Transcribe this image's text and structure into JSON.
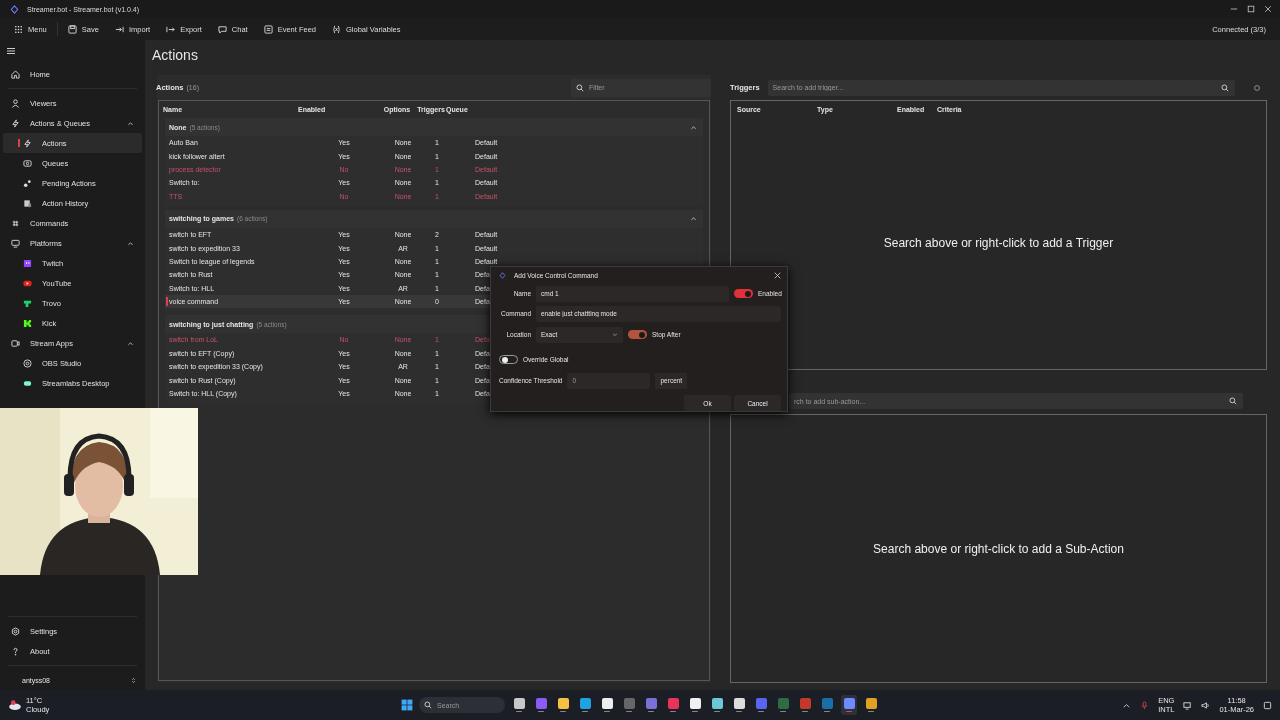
{
  "window": {
    "title": "Streamer.bot - Streamer.bot (v1.0.4)"
  },
  "toolbar": {
    "items": [
      {
        "label": "Menu"
      },
      {
        "label": "Save"
      },
      {
        "label": "Import"
      },
      {
        "label": "Export"
      },
      {
        "label": "Chat"
      },
      {
        "label": "Event Feed"
      },
      {
        "label": "Global Variables"
      }
    ],
    "status": "Connected (3/3)"
  },
  "sidebar": {
    "items": [
      {
        "label": "Home",
        "selected": false
      },
      {
        "label": "Viewers",
        "selected": false
      },
      {
        "label": "Actions & Queues",
        "selected": false,
        "expanded": true,
        "children": [
          {
            "label": "Actions",
            "selected": true
          },
          {
            "label": "Queues",
            "selected": false
          },
          {
            "label": "Pending Actions",
            "selected": false
          },
          {
            "label": "Action History",
            "selected": false
          }
        ]
      },
      {
        "label": "Commands",
        "selected": false
      },
      {
        "label": "Platforms",
        "selected": false,
        "expanded": true,
        "children": [
          {
            "label": "Twitch",
            "selected": false
          },
          {
            "label": "YouTube",
            "selected": false
          },
          {
            "label": "Trovo",
            "selected": false
          },
          {
            "label": "Kick",
            "selected": false
          }
        ]
      },
      {
        "label": "Stream Apps",
        "selected": false,
        "expanded": true,
        "children": [
          {
            "label": "OBS Studio",
            "selected": false
          },
          {
            "label": "Streamlabs Desktop",
            "selected": false
          }
        ]
      }
    ],
    "footer": [
      {
        "label": "Settings"
      },
      {
        "label": "About"
      }
    ],
    "user": "antyss08"
  },
  "page_title": "Actions",
  "actions_panel": {
    "title": "Actions",
    "count": "(16)",
    "filter": {
      "placeholder": "Filter"
    },
    "columns": [
      "Name",
      "Enabled",
      "Options",
      "Triggers",
      "Queue"
    ],
    "groups": [
      {
        "name": "None",
        "count": "(5 actions)",
        "expanded": true,
        "rows": [
          {
            "name": "Auto Ban",
            "enabled_text": "Yes",
            "options": "None",
            "triggers": "1",
            "queue": "Default",
            "enabled": true,
            "selected": false
          },
          {
            "name": "kick follower altert",
            "enabled_text": "Yes",
            "options": "None",
            "triggers": "1",
            "queue": "Default",
            "enabled": true,
            "selected": false
          },
          {
            "name": "process detector",
            "enabled_text": "No",
            "options": "None",
            "triggers": "1",
            "queue": "Default",
            "enabled": false,
            "selected": false
          },
          {
            "name": "Switch to:",
            "enabled_text": "Yes",
            "options": "None",
            "triggers": "1",
            "queue": "Default",
            "enabled": true,
            "selected": false
          },
          {
            "name": "TTS",
            "enabled_text": "No",
            "options": "None",
            "triggers": "1",
            "queue": "Default",
            "enabled": false,
            "selected": false
          }
        ]
      },
      {
        "name": "switching to games",
        "count": "(6 actions)",
        "expanded": true,
        "rows": [
          {
            "name": "switch to EFT",
            "enabled_text": "Yes",
            "options": "None",
            "triggers": "2",
            "queue": "Default",
            "enabled": true,
            "selected": false
          },
          {
            "name": "switch to expedition 33",
            "enabled_text": "Yes",
            "options": "AR",
            "triggers": "1",
            "queue": "Default",
            "enabled": true,
            "selected": false
          },
          {
            "name": "Switch to league of legends",
            "enabled_text": "Yes",
            "options": "None",
            "triggers": "1",
            "queue": "Default",
            "enabled": true,
            "selected": false
          },
          {
            "name": "switch to Rust",
            "enabled_text": "Yes",
            "options": "None",
            "triggers": "1",
            "queue": "Defa",
            "enabled": true,
            "selected": false
          },
          {
            "name": "Switch to: HLL",
            "enabled_text": "Yes",
            "options": "AR",
            "triggers": "1",
            "queue": "Defa",
            "enabled": true,
            "selected": false
          },
          {
            "name": "voice command",
            "enabled_text": "Yes",
            "options": "None",
            "triggers": "0",
            "queue": "Defa",
            "enabled": true,
            "selected": true
          }
        ]
      },
      {
        "name": "switching to just chatting",
        "count": "(5 actions)",
        "rows": [
          {
            "name": "switch from LoL",
            "enabled_text": "No",
            "options": "None",
            "triggers": "1",
            "queue": "Defa",
            "enabled": false,
            "selected": false
          },
          {
            "name": "switch to EFT (Copy)",
            "enabled_text": "Yes",
            "options": "None",
            "triggers": "1",
            "queue": "Defa",
            "enabled": true,
            "selected": false
          },
          {
            "name": "switch to expedition 33 (Copy)",
            "enabled_text": "Yes",
            "options": "AR",
            "triggers": "1",
            "queue": "Defa",
            "enabled": true,
            "selected": false
          },
          {
            "name": "switch to Rust (Copy)",
            "enabled_text": "Yes",
            "options": "None",
            "triggers": "1",
            "queue": "Defa",
            "enabled": true,
            "selected": false
          },
          {
            "name": "Switch to: HLL (Copy)",
            "enabled_text": "Yes",
            "options": "None",
            "triggers": "1",
            "queue": "Defa",
            "enabled": true,
            "selected": false
          }
        ]
      }
    ]
  },
  "triggers_panel": {
    "title": "Triggers",
    "search": {
      "placeholder": "Search to add trigger..."
    },
    "columns": [
      "Source",
      "Type",
      "Enabled",
      "Criteria"
    ],
    "empty_message": "Search above or right-click to add a Trigger"
  },
  "subactions_panel": {
    "search": {
      "placeholder": "rch to add sub-action..."
    },
    "empty_message": "Search above or right-click to add a Sub-Action"
  },
  "dialog": {
    "title": "Add Voice Control Command",
    "name_label": "Name",
    "name_value": "cmd 1",
    "enabled_label": "Enabled",
    "enabled": true,
    "command_label": "Command",
    "command_value": "enable just chattting mode",
    "location_label": "Location",
    "location_value": "Exact",
    "stop_after_label": "Stop After",
    "stop_after": true,
    "override_label": "Override Global",
    "override_global": false,
    "threshold_label": "Confidence Threshold",
    "threshold_placeholder": "0",
    "threshold_unit": "percent",
    "buttons": [
      "Ok",
      "Cancel"
    ]
  },
  "taskbar": {
    "weather": {
      "temp": "11°C",
      "condition": "Cloudy"
    },
    "search": {
      "placeholder": "Search"
    },
    "apps": [
      {
        "color": "#c8c8c8",
        "active": false
      },
      {
        "color": "#8a5cf6",
        "active": false
      },
      {
        "color": "#f5c242",
        "active": false
      },
      {
        "color": "#1fa2e0",
        "active": false
      },
      {
        "color": "#eeeeee",
        "active": false
      },
      {
        "color": "#666666",
        "active": false
      },
      {
        "color": "#7b6fd8",
        "active": false
      },
      {
        "color": "#e8335a",
        "active": false
      },
      {
        "color": "#f0f0f0",
        "active": false
      },
      {
        "color": "#6cc7d8",
        "active": false
      },
      {
        "color": "#dddddd",
        "active": false
      },
      {
        "color": "#5865f2",
        "active": false
      },
      {
        "color": "#2f6b45",
        "active": false
      },
      {
        "color": "#c0392b",
        "active": false
      },
      {
        "color": "#1b6fa8",
        "active": false
      },
      {
        "color": "#6b8cff",
        "active": true
      },
      {
        "color": "#e0a020",
        "active": false
      }
    ],
    "language": "ENG",
    "layout": "INTL",
    "time": "11:58",
    "date": "01-Mar-26"
  }
}
